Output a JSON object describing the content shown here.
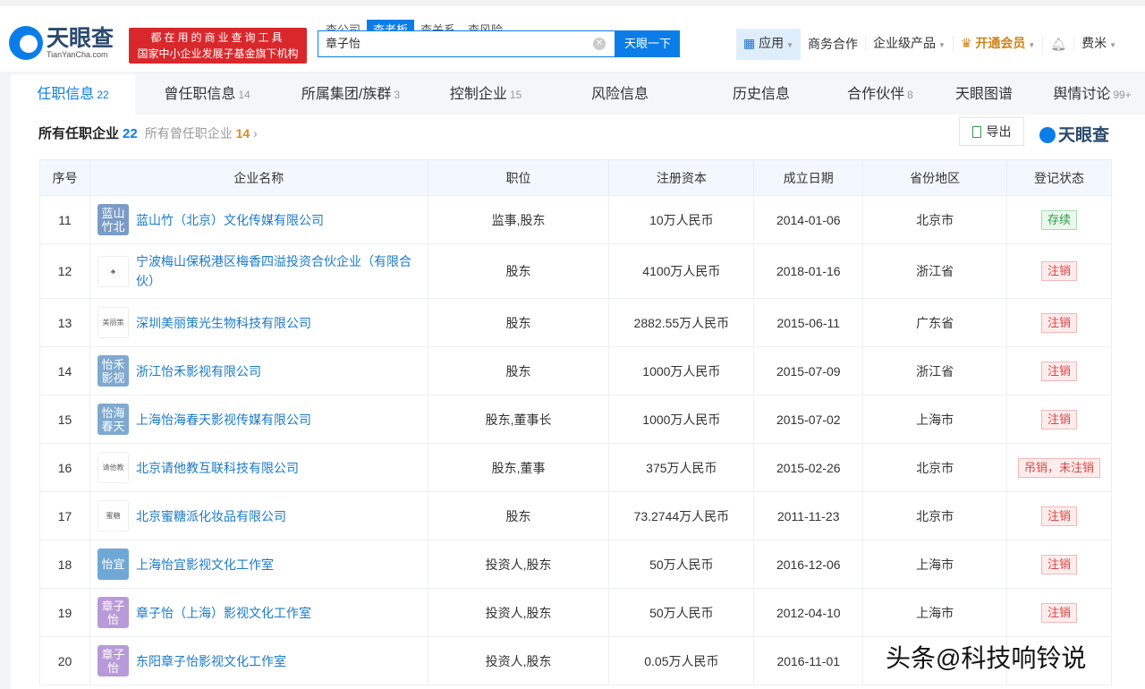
{
  "header": {
    "logo_cn": "天眼查",
    "logo_en": "TianYanCha.com",
    "slogan_line1": "都在用的商业查询工具",
    "slogan_line2": "国家中小企业发展子基金旗下机构",
    "search_tabs": [
      "查公司",
      "查老板",
      "查关系",
      "查风险"
    ],
    "search_value": "章子怡",
    "search_button": "天眼一下",
    "nav": {
      "app": "应用",
      "business": "商务合作",
      "enterprise": "企业级产品",
      "vip": "开通会员",
      "user": "费米"
    }
  },
  "tabs": [
    {
      "label": "任职信息",
      "count": "22"
    },
    {
      "label": "曾任职信息",
      "count": "14"
    },
    {
      "label": "所属集团/族群",
      "count": "3"
    },
    {
      "label": "控制企业",
      "count": "15"
    },
    {
      "label": "风险信息",
      "count": ""
    },
    {
      "label": "历史信息",
      "count": ""
    },
    {
      "label": "合作伙伴",
      "count": "8"
    },
    {
      "label": "天眼图谱",
      "count": ""
    },
    {
      "label": "舆情讨论",
      "count": "99+"
    }
  ],
  "section": {
    "title": "所有任职企业",
    "count": "22",
    "other": "所有曾任职企业",
    "other_count": "14",
    "export": "导出",
    "brand": "天眼查"
  },
  "table": {
    "headers": [
      "序号",
      "企业名称",
      "职位",
      "注册资本",
      "成立日期",
      "省份地区",
      "登记状态"
    ],
    "rows": [
      {
        "no": "11",
        "logo": "蓝山竹北",
        "logo_color": "#7b9cc6",
        "name": "蓝山竹（北京）文化传媒有限公司",
        "role": "监事,股东",
        "capital": "10万人民币",
        "date": "2014-01-06",
        "region": "北京市",
        "status": "存续",
        "ok": true
      },
      {
        "no": "12",
        "logo": "♣",
        "logo_color": "",
        "name": "宁波梅山保税港区梅香四溢投资合伙企业（有限合伙）",
        "role": "股东",
        "capital": "4100万人民币",
        "date": "2018-01-16",
        "region": "浙江省",
        "status": "注销"
      },
      {
        "no": "13",
        "logo": "美丽策",
        "logo_color": "",
        "name": "深圳美丽策光生物科技有限公司",
        "role": "股东",
        "capital": "2882.55万人民币",
        "date": "2015-06-11",
        "region": "广东省",
        "status": "注销"
      },
      {
        "no": "14",
        "logo": "怡禾影视",
        "logo_color": "#7fa9d0",
        "name": "浙江怡禾影视有限公司",
        "role": "股东",
        "capital": "1000万人民币",
        "date": "2015-07-09",
        "region": "浙江省",
        "status": "注销"
      },
      {
        "no": "15",
        "logo": "怡海春天",
        "logo_color": "#7fa9d0",
        "name": "上海怡海春天影视传媒有限公司",
        "role": "股东,董事长",
        "capital": "1000万人民币",
        "date": "2015-07-02",
        "region": "上海市",
        "status": "注销"
      },
      {
        "no": "16",
        "logo": "请他教",
        "logo_color": "",
        "name": "北京请他教互联科技有限公司",
        "role": "股东,董事",
        "capital": "375万人民币",
        "date": "2015-02-26",
        "region": "北京市",
        "status": "吊销，未注销"
      },
      {
        "no": "17",
        "logo": "蜜糖",
        "logo_color": "",
        "name": "北京蜜糖派化妆品有限公司",
        "role": "股东",
        "capital": "73.2744万人民币",
        "date": "2011-11-23",
        "region": "北京市",
        "status": "注销"
      },
      {
        "no": "18",
        "logo": "怡宜",
        "logo_color": "#6fa8d6",
        "name": "上海怡宜影视文化工作室",
        "role": "投资人,股东",
        "capital": "50万人民币",
        "date": "2016-12-06",
        "region": "上海市",
        "status": "注销"
      },
      {
        "no": "19",
        "logo": "章子怡",
        "logo_color": "#b99ad8",
        "name": "章子怡（上海）影视文化工作室",
        "role": "投资人,股东",
        "capital": "50万人民币",
        "date": "2012-04-10",
        "region": "上海市",
        "status": "注销"
      },
      {
        "no": "20",
        "logo": "章子怡",
        "logo_color": "#b99ad8",
        "name": "东阳章子怡影视文化工作室",
        "role": "投资人,股东",
        "capital": "0.05万人民币",
        "date": "2016-11-01",
        "region": "",
        "status": ""
      }
    ]
  },
  "watermark": "头条@科技响铃说"
}
